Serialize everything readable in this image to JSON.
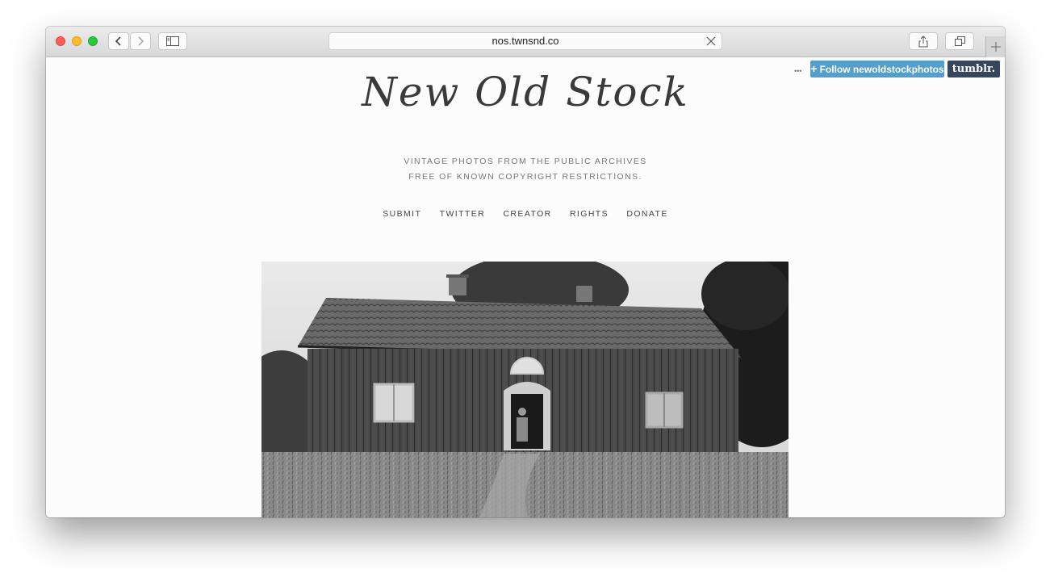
{
  "browser": {
    "url": "nos.twnsnd.co"
  },
  "tumblr_bar": {
    "follow_label": "Follow newoldstockphotos",
    "brand": "tumblr."
  },
  "site": {
    "logo": "New Old Stock",
    "tagline_line1": "VINTAGE PHOTOS FROM THE PUBLIC ARCHIVES",
    "tagline_line2": "FREE OF KNOWN COPYRIGHT RESTRICTIONS.",
    "nav": [
      "SUBMIT",
      "TWITTER",
      "CREATOR",
      "RIGHTS",
      "DONATE"
    ]
  },
  "colors": {
    "follow_button": "#529ecc",
    "tumblr_logo_bg": "#36465d"
  },
  "icons": [
    "back-icon",
    "forward-icon",
    "sidebar-icon",
    "close-icon",
    "share-icon",
    "tabs-icon",
    "plus-icon",
    "more-dots-icon"
  ]
}
